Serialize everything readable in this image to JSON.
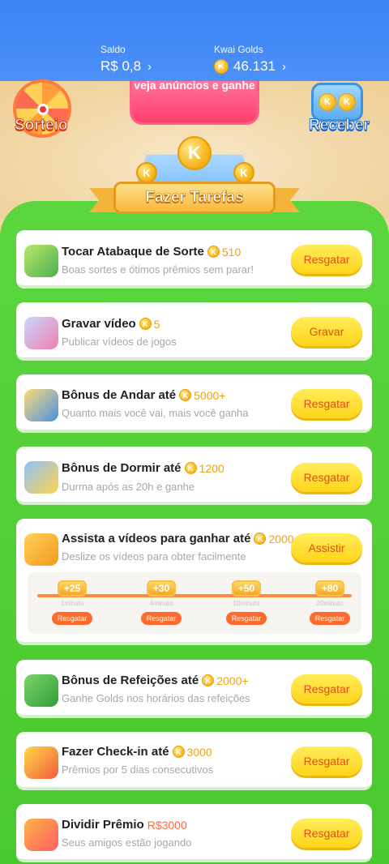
{
  "header": {
    "saldo_label": "Saldo",
    "saldo_value": "R$ 0,8",
    "golds_label": "Kwai Golds",
    "golds_value": "46.131",
    "chevron": "›"
  },
  "hero": {
    "sorteio_label": "Sorteio",
    "promo_text": "veja anúncios e ganhe",
    "receber_label": "Receber",
    "ribbon_title": "Fazer Tarefas",
    "coin_letter": "K"
  },
  "tasks": [
    {
      "title": "Tocar Atabaque de Sorte",
      "reward": "510",
      "sub": "Boas sortes e ótimos prêmios sem parar!",
      "button": "Resgatar",
      "icon": "drum-icon"
    },
    {
      "title": "Gravar vídeo",
      "reward": "5",
      "sub": "Publicar vídeos de jogos",
      "button": "Gravar",
      "icon": "camera-icon"
    },
    {
      "title": "Bônus de Andar até",
      "reward": "5000+",
      "sub": "Quanto mais você vai, mais você ganha",
      "button": "Resgatar",
      "icon": "walking-icon"
    },
    {
      "title": "Bônus de Dormir até",
      "reward": "1200",
      "sub": "Durma após as 20h e ganhe",
      "button": "Resgatar",
      "icon": "moon-icon"
    },
    {
      "title": "Assista a vídeos para ganhar até",
      "reward": "2000",
      "sub": "Deslize os vídeos para obter facilmente",
      "button": "Assistir",
      "icon": "video-camera-icon"
    },
    {
      "title": "Bônus de Refeições até",
      "reward": "2000+",
      "sub": "Ganhe Golds nos horários das refeições",
      "button": "Resgatar",
      "icon": "meal-icon"
    },
    {
      "title": "Fazer Check-in até",
      "reward": "3000",
      "sub": "Prêmios por 5 dias consecutivos",
      "button": "Resgatar",
      "icon": "calendar-icon"
    },
    {
      "title": "Dividir Prêmio",
      "reward": "R$3000",
      "sub": "Seus amigos estão jogando",
      "button": "Resgatar",
      "icon": "gift-icon"
    }
  ],
  "milestones": [
    {
      "plus": "+25",
      "min": "1minuto",
      "button": "Resgatar"
    },
    {
      "plus": "+30",
      "min": "4minuto",
      "button": "Resgatar"
    },
    {
      "plus": "+50",
      "min": "10minuto",
      "button": "Resgatar"
    },
    {
      "plus": "+80",
      "min": "20minuto",
      "button": "Resgatar"
    }
  ],
  "colors": {
    "header_blue": "#3a83f4",
    "panel_green": "#5bd63e",
    "button_yellow": "#ffd51a",
    "button_text": "#e14c16",
    "reward_gold": "#f2a10a",
    "milestone_orange": "#ff6b2c"
  }
}
